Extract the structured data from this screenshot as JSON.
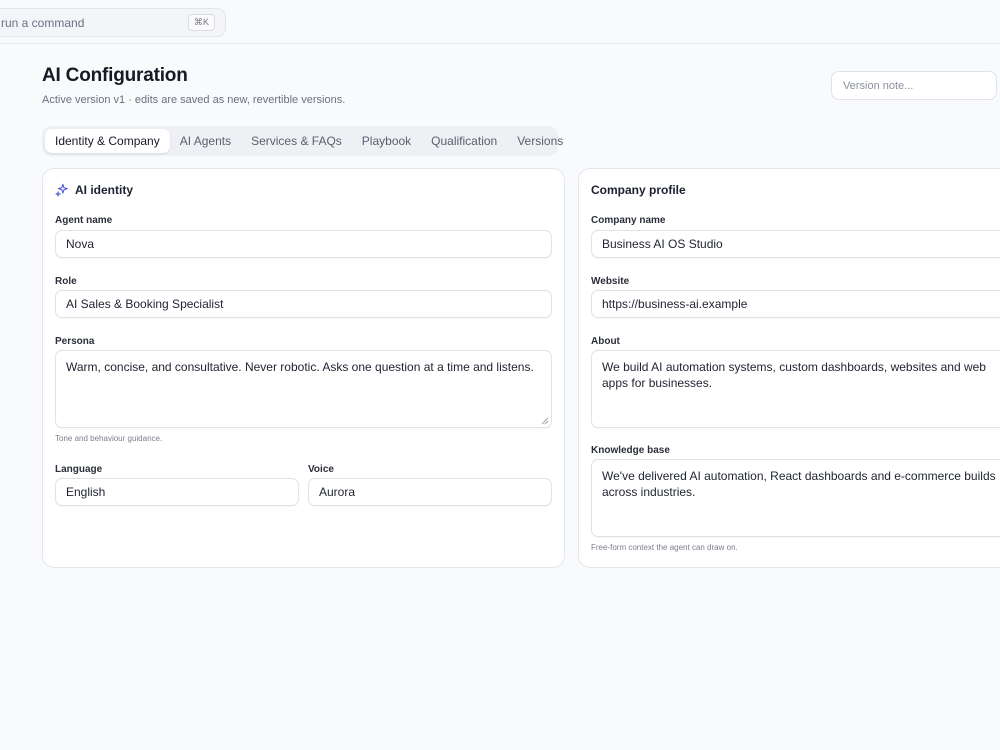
{
  "topbar": {
    "command_placeholder": "run a command",
    "shortcut": "⌘K"
  },
  "header": {
    "title": "AI Configuration",
    "subtitle": "Active version v1 · edits are saved as new, revertible versions.",
    "version_note_placeholder": "Version note..."
  },
  "tabs": [
    {
      "label": "Identity & Company",
      "active": true
    },
    {
      "label": "AI Agents",
      "active": false
    },
    {
      "label": "Services & FAQs",
      "active": false
    },
    {
      "label": "Playbook",
      "active": false
    },
    {
      "label": "Qualification",
      "active": false
    },
    {
      "label": "Versions",
      "active": false
    }
  ],
  "identity": {
    "title": "AI identity",
    "agent_name_label": "Agent name",
    "agent_name": "Nova",
    "role_label": "Role",
    "role": "AI Sales & Booking Specialist",
    "persona_label": "Persona",
    "persona": "Warm, concise, and consultative. Never robotic. Asks one question at a time and listens.",
    "persona_hint": "Tone and behaviour guidance.",
    "language_label": "Language",
    "language": "English",
    "voice_label": "Voice",
    "voice": "Aurora"
  },
  "company": {
    "title": "Company profile",
    "name_label": "Company name",
    "name": "Business AI OS Studio",
    "website_label": "Website",
    "website": "https://business-ai.example",
    "about_label": "About",
    "about": "We build AI automation systems, custom dashboards, websites and web apps for businesses.",
    "kb_label": "Knowledge base",
    "kb": "We've delivered AI automation, React dashboards and e-commerce builds across industries.",
    "kb_hint": "Free-form context the agent can draw on."
  },
  "colors": {
    "accent": "#4f5bd5",
    "background": "#f9fafc",
    "border": "#e3e6ed"
  }
}
